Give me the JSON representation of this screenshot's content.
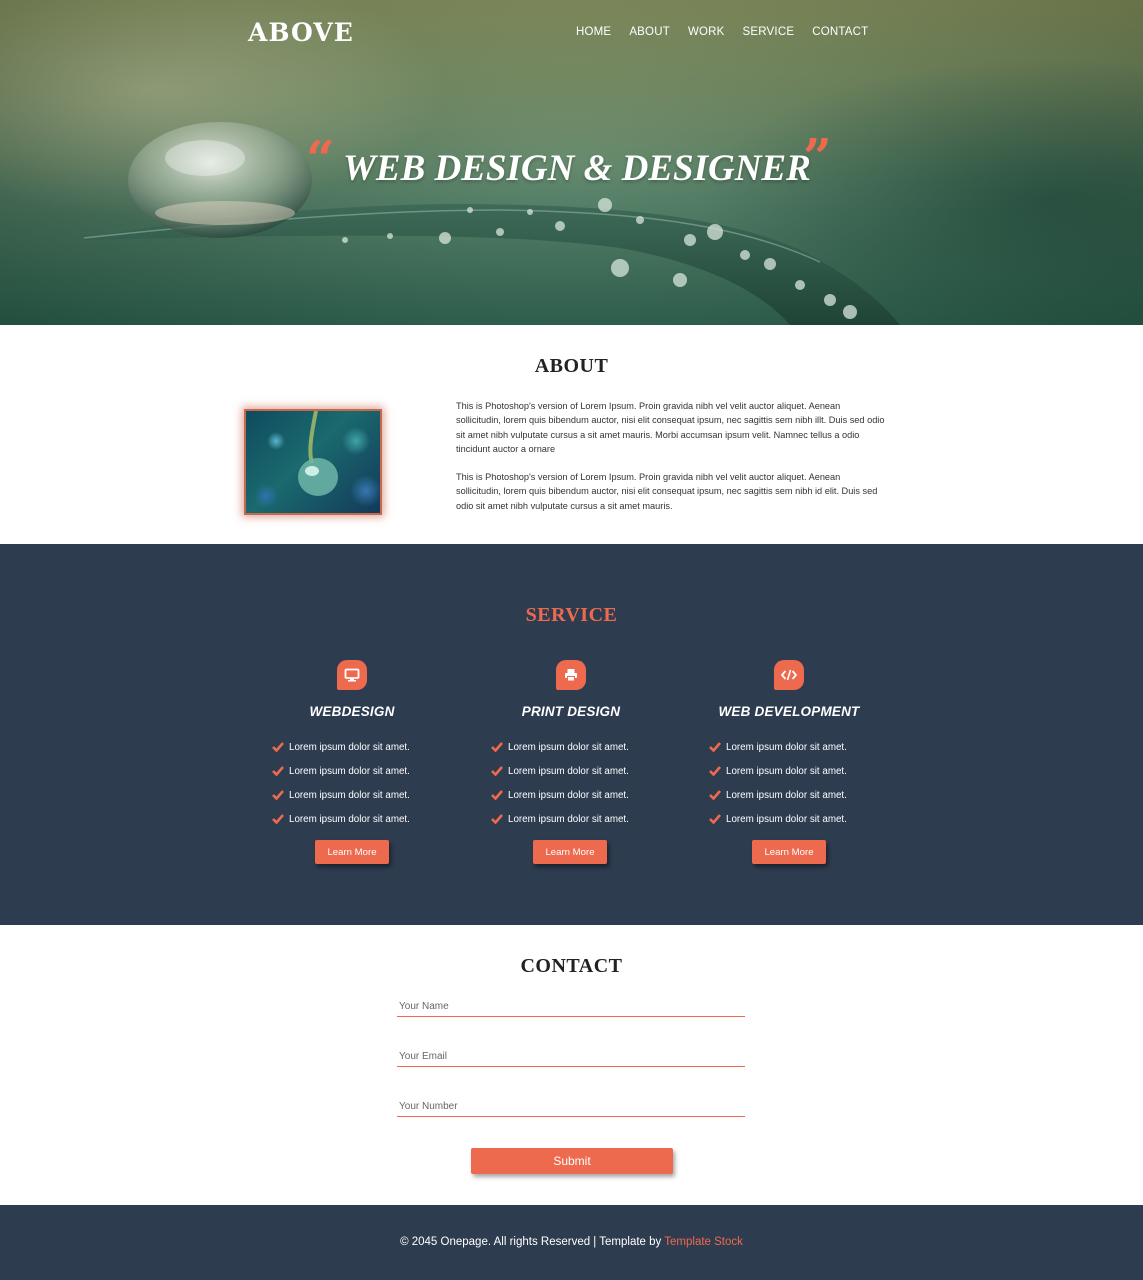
{
  "brand": {
    "logo": "ABOVE"
  },
  "nav": {
    "items": [
      "HOME",
      "ABOUT",
      "WORK",
      "SERVICE",
      "CONTACT"
    ]
  },
  "hero": {
    "quote_open": "“",
    "quote_close": "”",
    "title": "WEB DESIGN & DESIGNER"
  },
  "about": {
    "title": "ABOUT",
    "paragraphs": [
      "This is Photoshop's version of Lorem Ipsum. Proin gravida nibh vel velit auctor aliquet. Aenean sollicitudin, lorem quis bibendum auctor, nisi elit consequat ipsum, nec sagittis sem nibh illt. Duis sed odio sit amet nibh vulputate cursus a sit amet mauris. Morbi accumsan ipsum velit. Namnec tellus a odio tincidunt auctor a ornare",
      "This is Photoshop's version of Lorem Ipsum. Proin gravida nibh vel velit auctor aliquet. Aenean sollicitudin, lorem quis bibendum auctor, nisi elit consequat ipsum, nec sagittis sem nibh id elit. Duis sed odio sit amet nibh vulputate cursus a sit amet mauris."
    ]
  },
  "service": {
    "title": "SERVICE",
    "columns": [
      {
        "icon": "monitor-icon",
        "title": "WEBDESIGN",
        "items": [
          "Lorem ipsum dolor sit amet.",
          "Lorem ipsum dolor sit amet.",
          "Lorem ipsum dolor sit amet.",
          "Lorem ipsum dolor sit amet."
        ],
        "button": "Learn More"
      },
      {
        "icon": "printer-icon",
        "title": "PRINT DESIGN",
        "items": [
          "Lorem ipsum dolor sit amet.",
          "Lorem ipsum dolor sit amet.",
          "Lorem ipsum dolor sit amet.",
          "Lorem ipsum dolor sit amet."
        ],
        "button": "Learn More"
      },
      {
        "icon": "code-icon",
        "title": "WEB DEVELOPMENT",
        "items": [
          "Lorem ipsum dolor sit amet.",
          "Lorem ipsum dolor sit amet.",
          "Lorem ipsum dolor sit amet.",
          "Lorem ipsum dolor sit amet."
        ],
        "button": "Learn More"
      }
    ]
  },
  "contact": {
    "title": "CONTACT",
    "fields": {
      "name_placeholder": "Your Name",
      "email_placeholder": "Your Email",
      "number_placeholder": "Your Number"
    },
    "submit": "Submit"
  },
  "footer": {
    "copyright": "© 2045 Onepage. All rights Reserved | Template by ",
    "link": "Template Stock"
  },
  "colors": {
    "accent": "#ee6a4f",
    "navy": "#2e3c50",
    "white": "#ffffff"
  }
}
